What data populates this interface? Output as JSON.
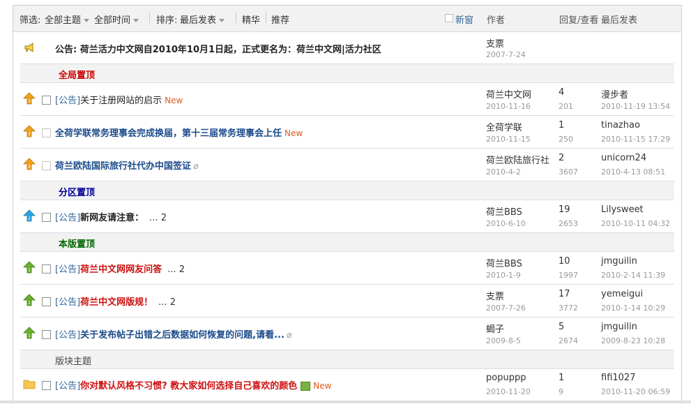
{
  "filter": {
    "label": "筛选:",
    "all_topics": "全部主题",
    "all_time": "全部时间",
    "sort_label": "排序:",
    "sort_value": "最后发表",
    "digest": "精华",
    "recommend": "推荐",
    "new_window": "新窗"
  },
  "header": {
    "author": "作者",
    "reply_view": "回复/查看",
    "last_post": "最后发表"
  },
  "announcement": {
    "text": "公告: 荷兰活力中文网自2010年10月1日起，正式更名为：荷兰中文网|活力社区",
    "author": "支票",
    "date": "2007-7-24"
  },
  "sections": {
    "global": "全局置顶",
    "zone": "分区置顶",
    "board": "本版置顶",
    "topics": "版块主题"
  },
  "threads": [
    {
      "prefix": "[公告]",
      "title": "关于注册网站的启示",
      "new": "New",
      "author": "荷兰中文网",
      "date": "2010-11-16",
      "replies": "4",
      "views": "201",
      "last_user": "漫步者",
      "last_time": "2010-11-19 13:54"
    },
    {
      "prefix": "",
      "title": "全荷学联常务理事会完成换届，第十三届常务理事会上任",
      "new": "New",
      "author": "全荷学联",
      "date": "2010-11-15",
      "replies": "1",
      "views": "250",
      "last_user": "tinazhao",
      "last_time": "2010-11-15 17:29"
    },
    {
      "prefix": "",
      "title": "荷兰欧陆国际旅行社代办中国签证",
      "author": "荷兰欧陆旅行社",
      "date": "2010-4-2",
      "replies": "2",
      "views": "3607",
      "last_user": "unicorn24",
      "last_time": "2010-4-13 08:51"
    },
    {
      "prefix": "[公告]",
      "title": "新网友请注意：",
      "pages": "... 2",
      "author": "荷兰BBS",
      "date": "2010-6-10",
      "replies": "19",
      "views": "2653",
      "last_user": "Lilysweet",
      "last_time": "2010-10-11 04:32"
    },
    {
      "prefix": "[公告]",
      "title": "荷兰中文网网友问答",
      "pages": "... 2",
      "author": "荷兰BBS",
      "date": "2010-1-9",
      "replies": "10",
      "views": "1997",
      "last_user": "jmguilin",
      "last_time": "2010-2-14 11:39"
    },
    {
      "prefix": "[公告]",
      "title": "荷兰中文网版规！",
      "pages": "... 2",
      "author": "支票",
      "date": "2007-7-26",
      "replies": "17",
      "views": "3772",
      "last_user": "yemeigui",
      "last_time": "2010-1-14 10:29"
    },
    {
      "prefix": "[公告]",
      "title": "关于发布帖子出错之后数据如何恢复的问题,请看...",
      "author": "蝎子",
      "date": "2009-8-5",
      "replies": "5",
      "views": "2674",
      "last_user": "jmguilin",
      "last_time": "2009-8-23 10:28"
    },
    {
      "prefix": "[公告]",
      "title": "你对默认风格不习惯? 教大家如何选择自己喜欢的颜色",
      "new": "New",
      "author": "popuppp",
      "date": "2010-11-20",
      "replies": "1",
      "views": "9",
      "last_user": "fifi1027",
      "last_time": "2010-11-20 06:59"
    }
  ],
  "colors": {
    "global_section": "#cc0000",
    "zone_section": "#000099",
    "board_section": "#006600",
    "arrow_global": "#f0a020",
    "arrow_zone": "#2aa6e0",
    "arrow_board": "#6aae2c"
  }
}
